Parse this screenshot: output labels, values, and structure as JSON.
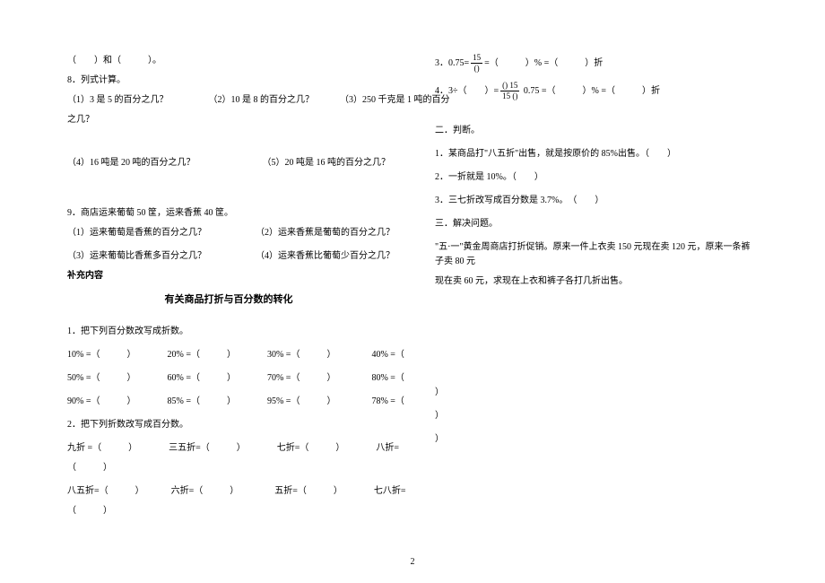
{
  "col1": {
    "line1": "（　　）和（　　　）。",
    "q8": "8．列式计算。",
    "q8_1": "（1）3 是 5 的百分之几？",
    "q8_2": "（2）10 是 8 的百分之几？",
    "q8_3": "（3）250 千克是 1 吨的百分",
    "q8_3b": "之几？",
    "q8_4": "（4）16 吨是 20 吨的百分之几？",
    "q8_5": "（5）20 吨是 16 吨的百分之几？",
    "q9": "9．商店运来葡萄 50 筐，运来香蕉 40 筐。",
    "q9_1": "（1）运来葡萄是香蕉的百分之几？",
    "q9_2": "（2）运来香蕉是葡萄的百分之几？",
    "q9_3": "（3）运来葡萄比香蕉多百分之几？",
    "q9_4": "（4）运来香蕉比葡萄少百分之几？",
    "supp": "补充内容",
    "title": "有关商品打折与百分数的转化",
    "p1": "1．把下列百分数改写成折数。",
    "p1_10": "10% =（　　　）",
    "p1_20": "20% =（　　　）",
    "p1_30": "30% =（　　　）",
    "p1_40": "40% =（",
    "p1_50": "50% =（　　　）",
    "p1_60": "60% =（　　　）",
    "p1_70": "70% =（　　　）",
    "p1_80": "80% =（",
    "p1_90": "90% =（　　　）",
    "p1_85": "85% =（　　　）",
    "p1_95": "95% =（　　　）",
    "p1_78": "78% =（",
    "p2": "2．把下列折数改写成百分数。",
    "p2_9": "九折 =（　　　）",
    "p2_35": "三五折=（　　　）",
    "p2_7": "七折=（　　　）",
    "p2_8": "八折=",
    "p2_blank1": "（　　　）",
    "p2_85": "八五折=（　　　）",
    "p2_6": "六折=（　　　）",
    "p2_5": "五折=（　　　）",
    "p2_78": "七八折=",
    "p2_blank2": "（　　　）",
    "p3a": "3．0.75=",
    "p3b": "=（　　　）% =（　　　）折",
    "f3num": "15",
    "f3den": "()"
  },
  "col2": {
    "p4a": "4．3÷（　　）=",
    "p4b": "0.75 =（　　　）% =（　　　）折",
    "f4num": "() 15",
    "f4den": "15 ()",
    "sec2": "二．判断。",
    "j1": "1．某商品打\"八五折\"出售，就是按原价的 85%出售。（　　）",
    "j2": "2．一折就是 10%。（　　）",
    "j3": "3．三七折改写成百分数是 3.7%。　（　　）",
    "sec3": "三．解决问题。",
    "w1": "\"五·一\"黄金周商店打折促销。原来一件上衣卖 150 元现在卖 120 元，原来一条裤子卖 80 元",
    "w2": "现在卖 60 元，求现在上衣和裤子各打几折出售。",
    "closep": "）"
  },
  "page": "2"
}
